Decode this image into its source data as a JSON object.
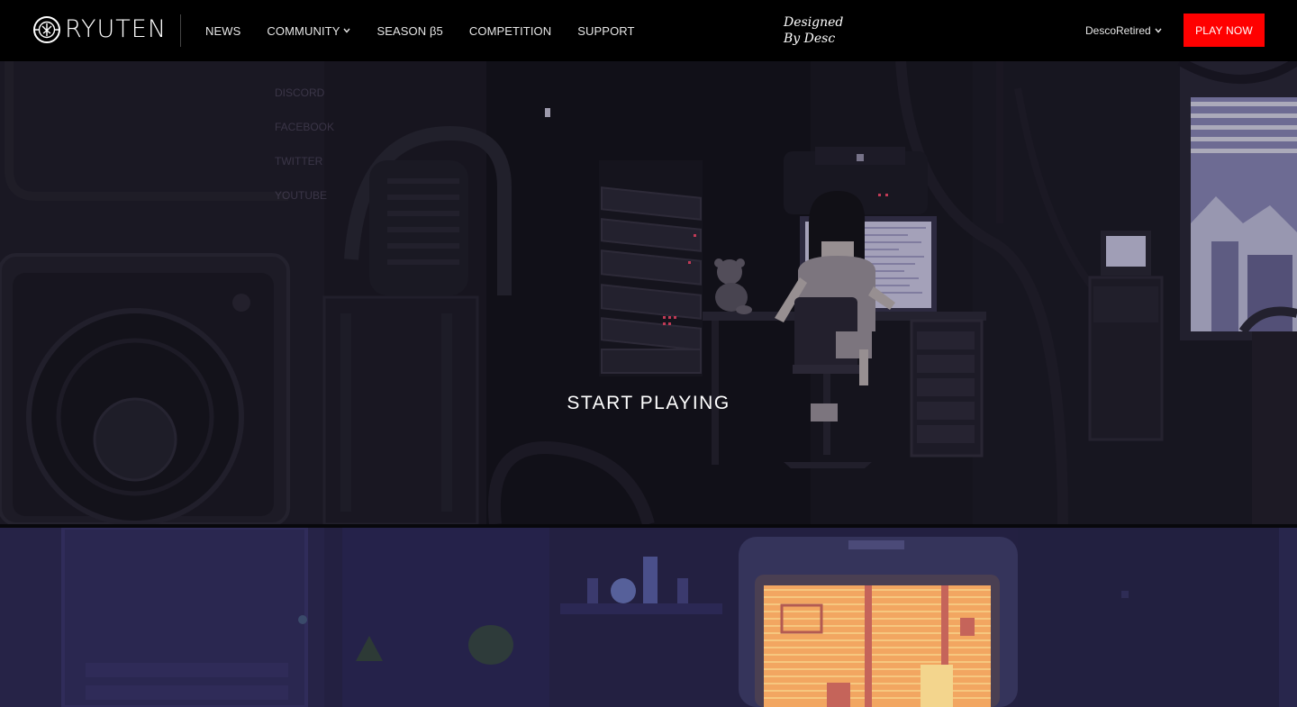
{
  "brand": {
    "name": "RYUTEN",
    "logo_icon": "ryuten-emblem-icon"
  },
  "nav": {
    "items": [
      {
        "label": "NEWS",
        "dropdown": false
      },
      {
        "label": "COMMUNITY",
        "dropdown": true
      },
      {
        "label": "SEASON β5",
        "dropdown": false
      },
      {
        "label": "COMPETITION",
        "dropdown": false
      },
      {
        "label": "SUPPORT",
        "dropdown": false
      }
    ]
  },
  "credit": {
    "line1": "Designed",
    "line2": "By Desc"
  },
  "user": {
    "name": "DescoRetired",
    "dropdown_icon": "chevron-down-icon"
  },
  "cta": {
    "label": "PLAY NOW",
    "color": "#ff0000"
  },
  "hero": {
    "headline": "START PLAYING",
    "ghost_links": [
      "DISCORD",
      "FACEBOOK",
      "TWITTER",
      "YOUTUBE"
    ]
  },
  "colors": {
    "header_bg": "#000000",
    "accent": "#ff0000",
    "hero_bg": "#19171f",
    "scene2_bg": "#221f3d"
  }
}
